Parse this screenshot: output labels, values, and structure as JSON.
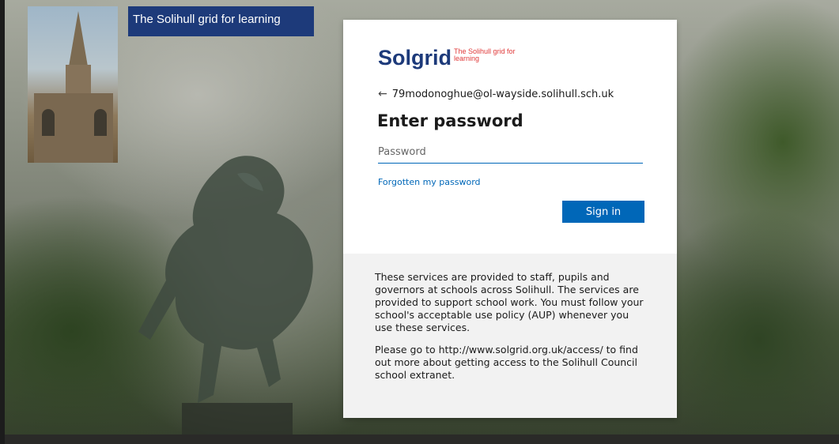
{
  "background": {
    "banner_text": "The Solihull grid for learning"
  },
  "brand": {
    "name": "Solgrid",
    "tagline": "The Solihull grid for learning",
    "name_color": "#1d3a7a",
    "tagline_color": "#e03a3a"
  },
  "login": {
    "back_icon": "arrow-left-icon",
    "account_email": "79modonoghue@ol-wayside.solihull.sch.uk",
    "title": "Enter password",
    "password_placeholder": "Password",
    "password_value": "",
    "forgot_link": "Forgotten my password",
    "signin_label": "Sign in",
    "accent_color": "#0067b8"
  },
  "info": {
    "paragraph1": "These services are provided to staff, pupils and governors at schools across Solihull. The services are provided to support school work. You must follow your school's acceptable use policy (AUP) whenever you use these services.",
    "paragraph2": "Please go to http://www.solgrid.org.uk/access/ to find out more about getting access to the Solihull Council school extranet."
  }
}
